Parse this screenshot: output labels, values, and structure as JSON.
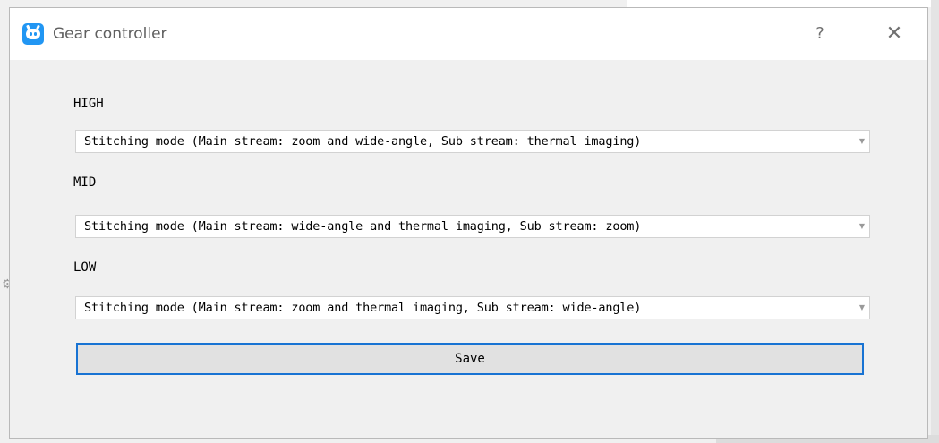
{
  "window": {
    "title": "Gear controller",
    "help_glyph": "?",
    "close_glyph": "✕"
  },
  "levels": [
    {
      "label": "HIGH",
      "selected": "Stitching mode (Main stream: zoom and wide-angle, Sub stream: thermal imaging)"
    },
    {
      "label": "MID",
      "selected": "Stitching mode (Main stream: wide-angle and thermal imaging, Sub stream: zoom)"
    },
    {
      "label": "LOW",
      "selected": "Stitching mode (Main stream: zoom and thermal imaging, Sub stream: wide-angle)"
    }
  ],
  "save_label": "Save",
  "icons": {
    "app": "app-robot-icon",
    "dropdown": "dropdown-arrow-icon",
    "background_gear": "gear-icon"
  },
  "colors": {
    "accent_border": "#1873d3",
    "app_icon": "#2196f3",
    "dialog_bg": "#f0f0f0",
    "titlebar_bg": "#ffffff"
  }
}
